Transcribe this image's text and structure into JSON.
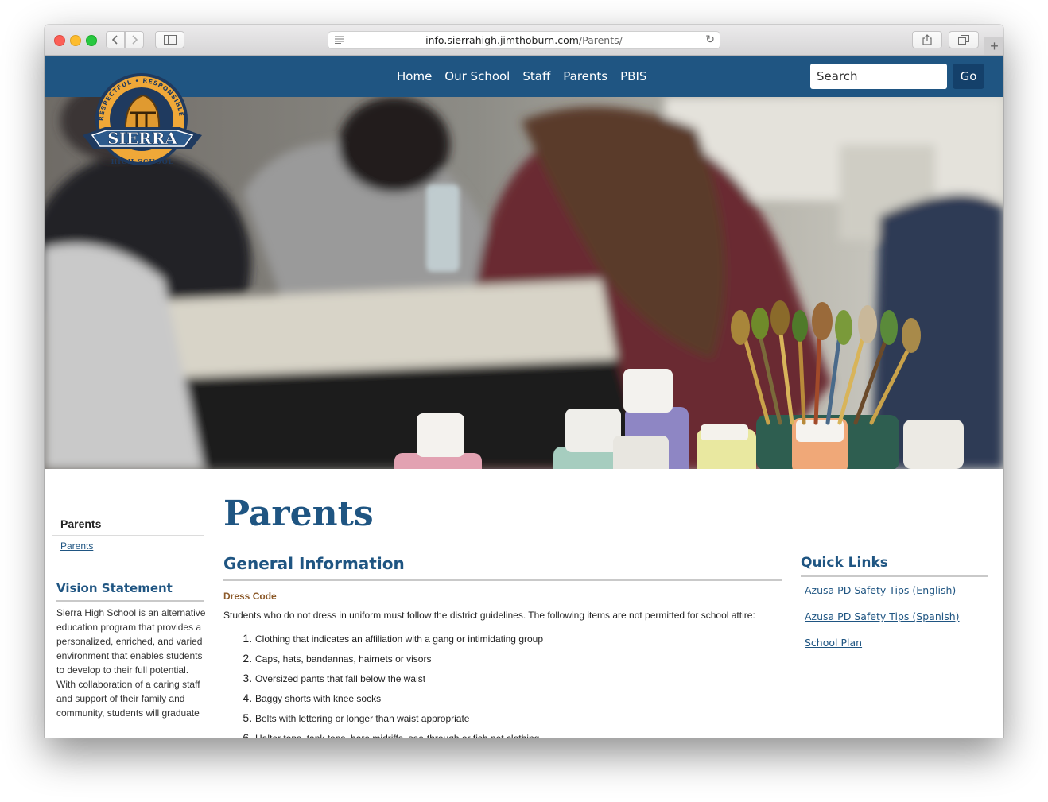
{
  "browser": {
    "url_host": "info.sierrahigh.jimthoburn.com",
    "url_path": "/Parents/"
  },
  "nav": {
    "links": [
      "Home",
      "Our School",
      "Staff",
      "Parents",
      "PBIS"
    ],
    "search_placeholder": "Search",
    "go_label": "Go"
  },
  "logo": {
    "arc_text": "RESPECTFUL • RESPONSIBLE • READY",
    "name": "SIERRA",
    "subtitle": "HIGH SCHOOL"
  },
  "sidebar": {
    "heading": "Parents",
    "link": "Parents",
    "vision_title": "Vision Statement",
    "vision_text": "Sierra High School is an alternative education program that provides a personalized, enriched, and varied environment that enables students to develop to their full potential. With collaboration of a caring staff and support of their family and community, students will graduate"
  },
  "main": {
    "page_title": "Parents",
    "section_title": "General Information",
    "sub_title": "Dress Code",
    "intro": "Students who do not dress in uniform must follow the district guidelines. The following items are not permitted for school attire:",
    "rules": [
      "Clothing that indicates an affiliation with a gang or intimidating group",
      "Caps, hats, bandannas, hairnets or visors",
      "Oversized pants that fall below the waist",
      "Baggy shorts with knee socks",
      "Belts with lettering or longer than waist appropriate",
      "Halter tops, tank tops, bare midriffs, see-through or fish net clothing"
    ]
  },
  "quick_links": {
    "title": "Quick Links",
    "links": [
      "Azusa PD Safety Tips (English)",
      "Azusa PD Safety Tips (Spanish)",
      "School Plan"
    ]
  }
}
